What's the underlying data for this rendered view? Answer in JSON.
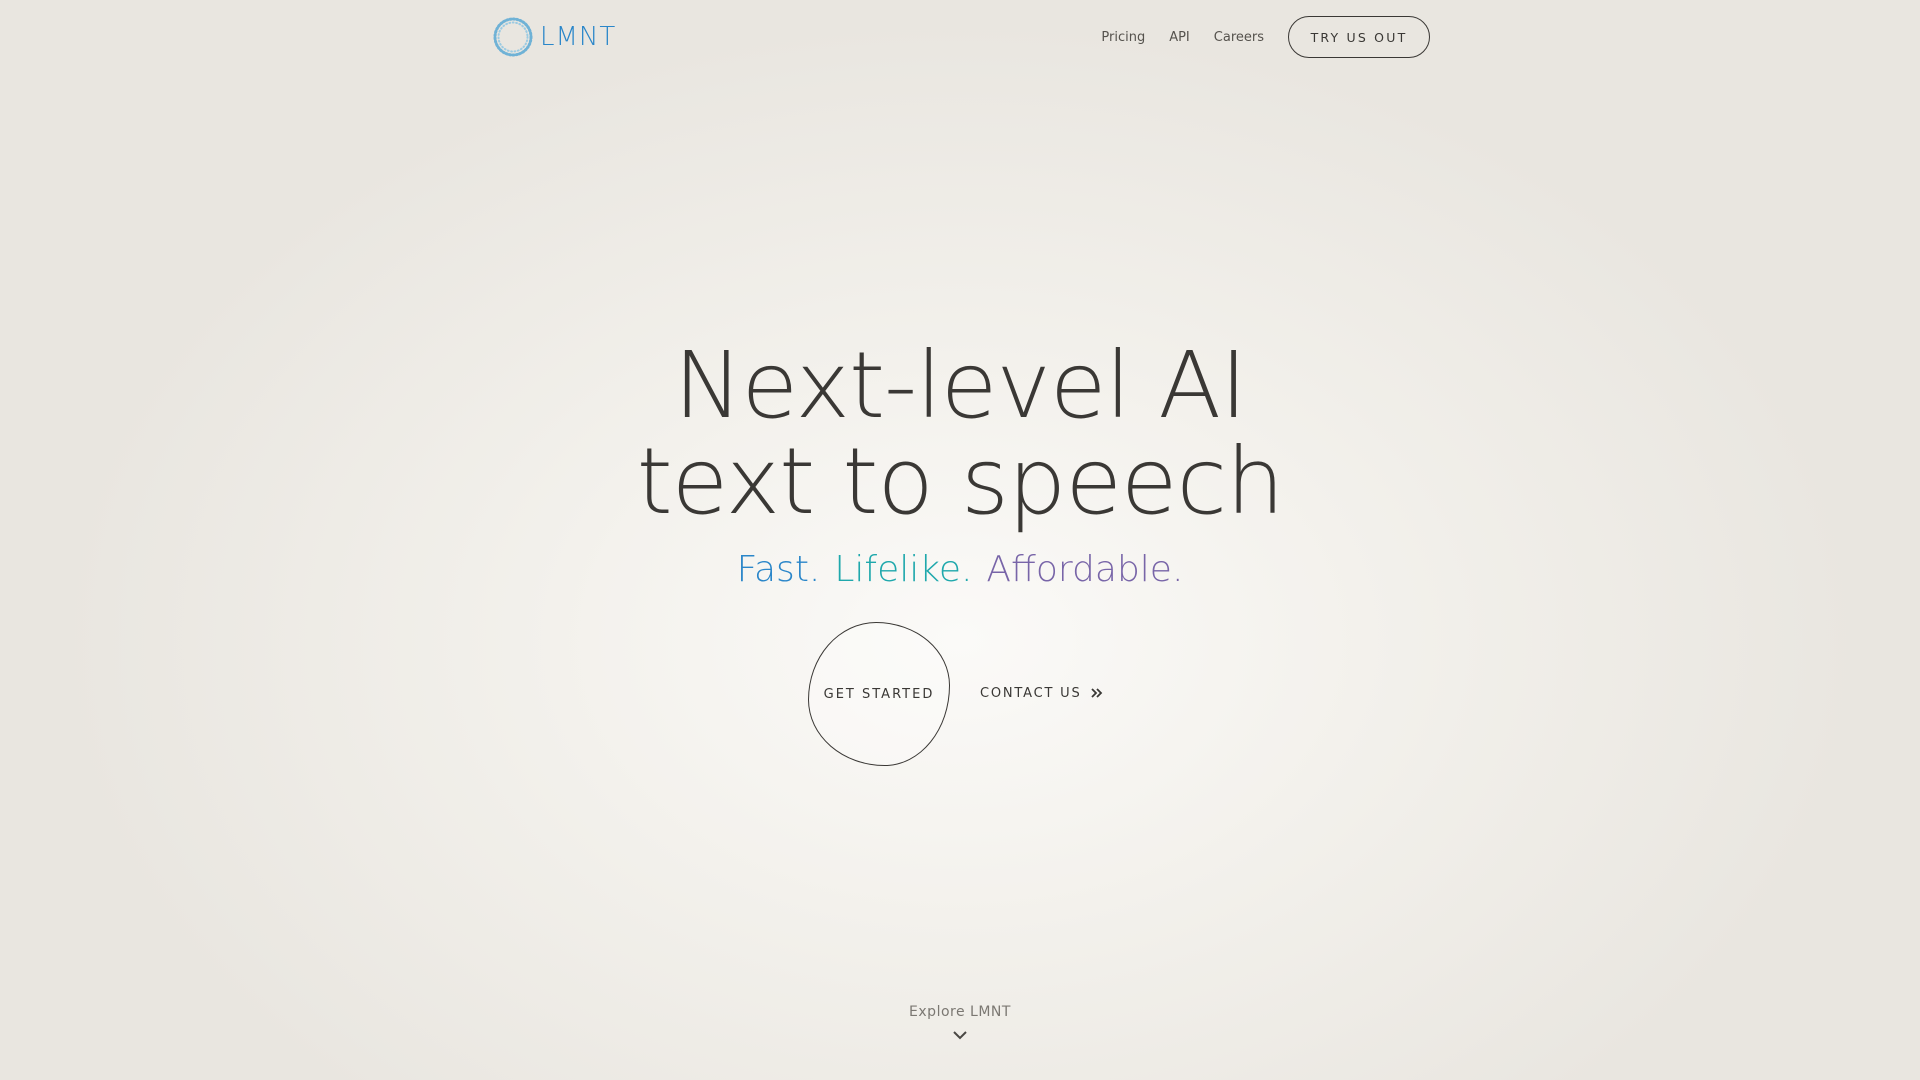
{
  "header": {
    "logo_text": "LMNT",
    "nav": [
      {
        "label": "Pricing"
      },
      {
        "label": "API"
      },
      {
        "label": "Careers"
      }
    ],
    "cta_label": "TRY US OUT"
  },
  "hero": {
    "title_line1": "Next-level AI",
    "title_line2": "text to speech",
    "tagline": [
      {
        "text": "Fast.",
        "color": "#2a86c9"
      },
      {
        "text": "Lifelike.",
        "color": "#1fa8ac"
      },
      {
        "text": "Affordable.",
        "color": "#7865a8"
      }
    ],
    "primary_button": "GET STARTED",
    "secondary_link": "CONTACT US"
  },
  "footer": {
    "explore_label": "Explore LMNT"
  },
  "colors": {
    "brand_blue": "#2a86c9",
    "text_dark": "#3a3835",
    "background": "#f1efea"
  },
  "icons": {
    "logo": "dotted-ring-logo-icon",
    "contact": "double-chevron-right-icon",
    "explore": "chevron-down-icon"
  }
}
